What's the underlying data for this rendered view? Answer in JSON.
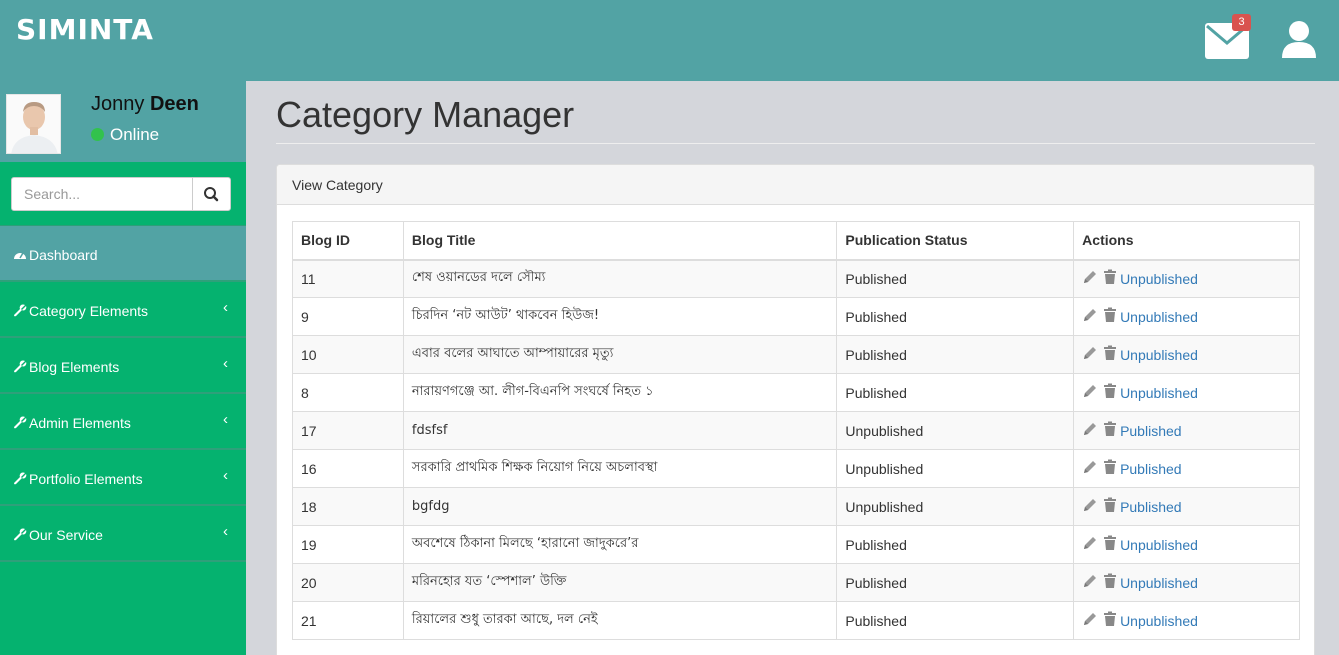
{
  "brand": "SIMINTA",
  "header": {
    "mail_count": "3"
  },
  "profile": {
    "first_name": "Jonny",
    "last_name": "Deen",
    "status": "Online"
  },
  "search": {
    "placeholder": "Search..."
  },
  "nav": [
    {
      "label": "Dashboard",
      "icon": "dashboard-icon"
    },
    {
      "label": "Category Elements",
      "icon": "wrench-icon"
    },
    {
      "label": "Blog Elements",
      "icon": "wrench-icon"
    },
    {
      "label": "Admin Elements",
      "icon": "wrench-icon"
    },
    {
      "label": "Portfolio Elements",
      "icon": "wrench-icon"
    },
    {
      "label": "Our Service",
      "icon": "wrench-icon"
    }
  ],
  "page": {
    "title": "Category Manager",
    "panel_heading": "View Category"
  },
  "table": {
    "headers": [
      "Blog ID",
      "Blog Title",
      "Publication Status",
      "Actions"
    ],
    "rows": [
      {
        "id": "11",
        "title": "শেষ ওয়ানডের দলে সৌম্য",
        "status": "Published",
        "action": "Unpublished"
      },
      {
        "id": "9",
        "title": "চিরদিন ‘নট আউট’ থাকবেন হিউজ!",
        "status": "Published",
        "action": "Unpublished"
      },
      {
        "id": "10",
        "title": "এবার বলের আঘাতে আম্পায়ারের মৃত্যু",
        "status": "Published",
        "action": "Unpublished"
      },
      {
        "id": "8",
        "title": "নারায়ণগঞ্জে আ. লীগ-বিএনপি সংঘর্ষে নিহত ১",
        "status": "Published",
        "action": "Unpublished"
      },
      {
        "id": "17",
        "title": "fdsfsf",
        "status": "Unpublished",
        "action": "Published"
      },
      {
        "id": "16",
        "title": "সরকারি প্রাথমিক শিক্ষক নিয়োগ নিয়ে অচলাবস্থা",
        "status": "Unpublished",
        "action": "Published"
      },
      {
        "id": "18",
        "title": "bgfdg",
        "status": "Unpublished",
        "action": "Published"
      },
      {
        "id": "19",
        "title": "অবশেষে ঠিকানা মিলছে ‘হারানো জাদুকরে’র",
        "status": "Published",
        "action": "Unpublished"
      },
      {
        "id": "20",
        "title": "মরিনহোর যত ‘স্পেশাল’ উক্তি",
        "status": "Published",
        "action": "Unpublished"
      },
      {
        "id": "21",
        "title": "রিয়ালের শুধু তারকা আছে, দল নেই",
        "status": "Published",
        "action": "Unpublished"
      }
    ]
  },
  "colors": {
    "header": "#52a3a4",
    "sidebar": "#05b26f",
    "link": "#337ab7",
    "badge": "#d9534f"
  }
}
